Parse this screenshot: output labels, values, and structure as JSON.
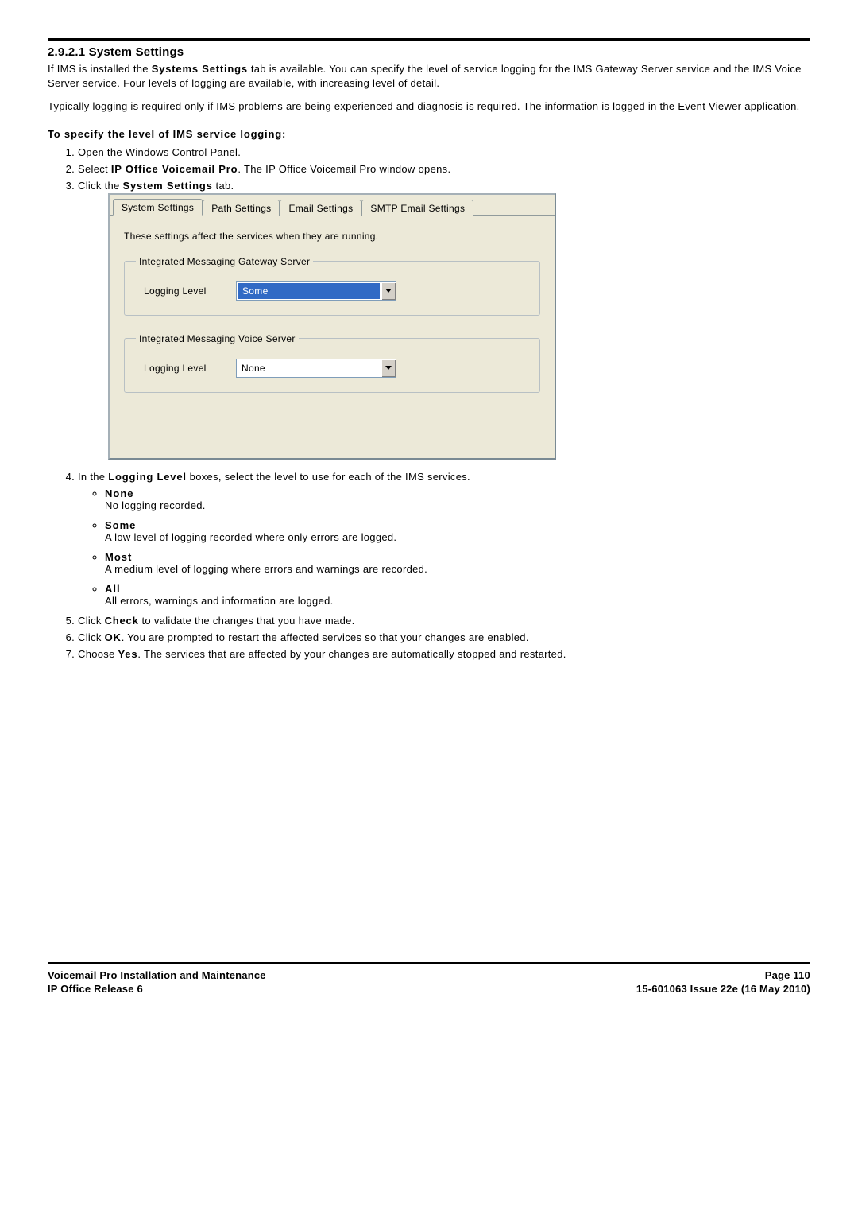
{
  "section": {
    "number": "2.9.2.1",
    "title": "System Settings",
    "full_title": "2.9.2.1 System Settings"
  },
  "paragraphs": {
    "p1a": "If IMS is installed the ",
    "p1_em": "Systems Settings",
    "p1b": " tab is available. You can specify the level of service logging for the IMS Gateway Server service and the IMS Voice Server service. Four levels of logging are available, with increasing level of detail.",
    "p2": "Typically logging is required only if IMS problems are being experienced and diagnosis is required. The information is logged in the Event Viewer application."
  },
  "subhead": "To specify the level of IMS service logging:",
  "steps": {
    "s1": "Open the Windows Control Panel.",
    "s2a": "Select ",
    "s2_em": "IP Office Voicemail Pro",
    "s2b": ". The IP Office Voicemail Pro window opens.",
    "s3a": "Click the ",
    "s3_em": "System Settings",
    "s3b": " tab.",
    "s4a": "In the ",
    "s4_em": "Logging Level",
    "s4b": " boxes, select the level to use for each of the IMS services.",
    "s5a": "Click ",
    "s5_em": "Check",
    "s5b": " to validate the changes that you have made.",
    "s6a": "Click ",
    "s6_em": "OK",
    "s6b": ". You are prompted to restart the affected services so that your changes are enabled.",
    "s7a": "Choose ",
    "s7_em": "Yes",
    "s7b": ". The services that are affected by your changes are automatically stopped and restarted."
  },
  "levels": {
    "none": {
      "name": "None",
      "desc": "No logging recorded."
    },
    "some": {
      "name": "Some",
      "desc": "A low level of logging recorded where only errors are logged."
    },
    "most": {
      "name": "Most",
      "desc": "A medium level of logging where errors and warnings are recorded."
    },
    "all": {
      "name": "All",
      "desc": "All errors, warnings and information are logged."
    }
  },
  "screenshot": {
    "tabs": {
      "t0": "System Settings",
      "t1": "Path Settings",
      "t2": "Email Settings",
      "t3": "SMTP Email Settings"
    },
    "desc": "These settings affect the services when they are running.",
    "group1": {
      "legend": "Integrated Messaging Gateway Server",
      "label": "Logging Level",
      "value": "Some"
    },
    "group2": {
      "legend": "Integrated Messaging Voice Server",
      "label": "Logging Level",
      "value": "None"
    }
  },
  "footer": {
    "left1": "Voicemail Pro Installation and Maintenance",
    "left2": "IP Office Release 6",
    "right1": "Page 110",
    "right2": "15-601063 Issue 22e (16 May 2010)"
  }
}
